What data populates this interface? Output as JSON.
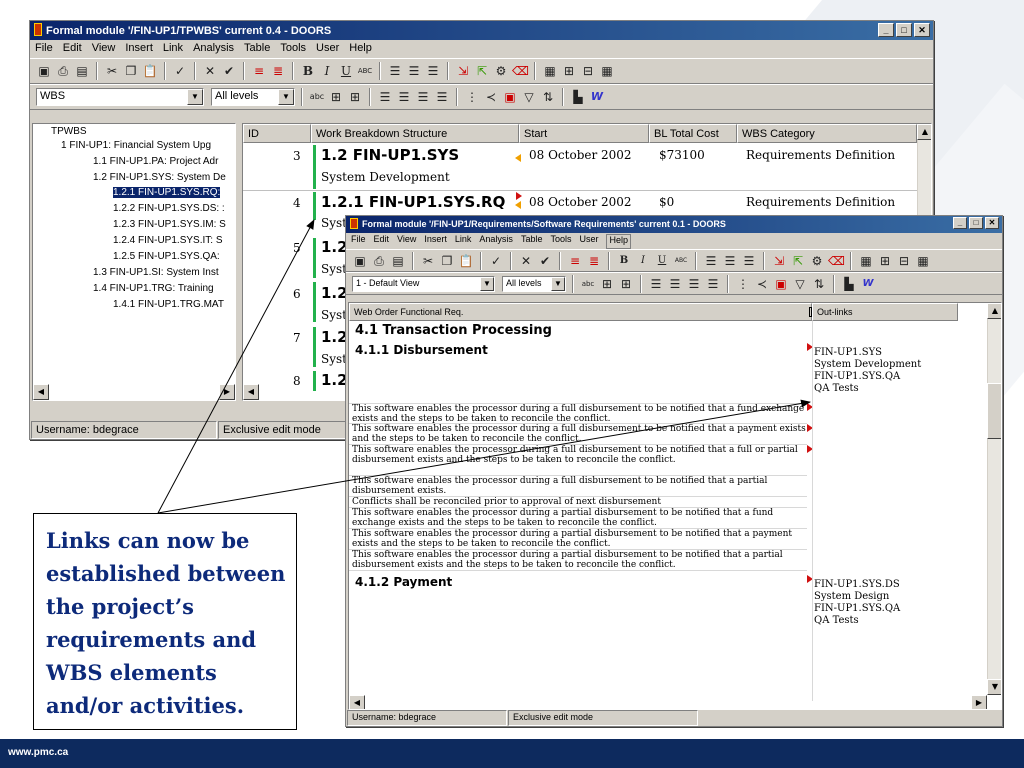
{
  "footer": {
    "url": "www.pmc.ca"
  },
  "main_window": {
    "title": "Formal module '/FIN-UP1/TPWBS' current 0.4 - DOORS",
    "menu": [
      "File",
      "Edit",
      "View",
      "Insert",
      "Link",
      "Analysis",
      "Table",
      "Tools",
      "User",
      "Help"
    ],
    "view_combo": "WBS",
    "level_combo": "All levels",
    "tree": [
      "TPWBS",
      "1 FIN-UP1: Financial System Upg",
      "1.1 FIN-UP1.PA: Project Adr",
      "1.2 FIN-UP1.SYS: System De",
      "1.2.1 FIN-UP1.SYS.RQ:",
      "1.2.2 FIN-UP1.SYS.DS: :",
      "1.2.3 FIN-UP1.SYS.IM: S",
      "1.2.4 FIN-UP1.SYS.IT: S",
      "1.2.5 FIN-UP1.SYS.QA:",
      "1.3 FIN-UP1.SI: System Inst",
      "1.4 FIN-UP1.TRG: Training",
      "1.4.1 FIN-UP1.TRG.MAT"
    ],
    "columns": [
      "ID",
      "Work Breakdown Structure",
      "Start",
      "BL Total Cost",
      "WBS Category"
    ],
    "rows": [
      {
        "id": "3",
        "wbs": "1.2 FIN-UP1.SYS",
        "sub": "System Development",
        "start": "08 October 2002",
        "cost": "$73100",
        "category": "Requirements Definition"
      },
      {
        "id": "4",
        "wbs": "1.2.1 FIN-UP1.SYS.RQ",
        "sub": "Syst",
        "start": "08 October 2002",
        "cost": "$0",
        "category": "Requirements Definition"
      },
      {
        "id": "5",
        "wbs": "1.2",
        "sub": "Syst"
      },
      {
        "id": "6",
        "wbs": "1.2",
        "sub": "Syst"
      },
      {
        "id": "7",
        "wbs": "1.2",
        "sub": "Syst"
      },
      {
        "id": "8",
        "wbs": "1.2",
        "sub": ""
      }
    ],
    "status_user": "Username: bdegrace",
    "status_mode": "Exclusive edit mode"
  },
  "child_window": {
    "title": "Formal module '/FIN-UP1/Requirements/Software Requirements' current 0.1 - DOORS",
    "menu": [
      "File",
      "Edit",
      "View",
      "Insert",
      "Link",
      "Analysis",
      "Table",
      "Tools",
      "User",
      "Help"
    ],
    "view_combo": "1 - Default View",
    "level_combo": "All levels",
    "columns": [
      "Web Order Functional Req.",
      "Out-links"
    ],
    "heading_41": "4.1 Transaction Processing",
    "heading_411": "4.1.1 Disbursement",
    "heading_412": "4.1.2 Payment",
    "outlinks_1": "FIN-UP1.SYS\nSystem Development\nFIN-UP1.SYS.QA\nQA Tests",
    "outlinks_2": "FIN-UP1.SYS.DS\nSystem Design\nFIN-UP1.SYS.QA\nQA Tests",
    "reqs": [
      "This software enables the processor during a full disbursement to be notified that a fund exchange exists and the steps to be taken to reconcile the conflict.",
      "This software enables the processor during a full disbursement to be notified that a payment exists and the steps to be taken to reconcile the conflict.",
      "This software enables the processor during a full disbursement to be notified that a full or partial disbursement exists and the steps to be taken to reconcile the conflict.",
      "This software enables the processor during a full disbursement to be notified that a partial disbursement exists.",
      "Conflicts shall be reconciled prior to approval of next disbursement",
      "This software enables the processor during a partial disbursement to be notified that a fund exchange exists and the steps to be taken to reconcile the conflict.",
      "This software enables the processor during a partial disbursement to be notified that a payment exists and the steps to be taken to reconcile the conflict.",
      "This software enables the processor during a partial disbursement to be notified that a partial disbursement exists and the steps to be taken to reconcile the conflict."
    ],
    "status_user": "Username: bdegrace",
    "status_mode": "Exclusive edit mode"
  },
  "callout_text": "Links can now be established between the project’s requirements and WBS elements and/or activities."
}
